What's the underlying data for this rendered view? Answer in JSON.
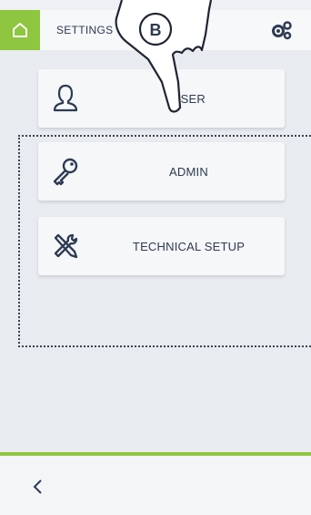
{
  "header": {
    "title": "SETTINGS",
    "home_icon": "home-icon",
    "settings_icon": "gears-icon"
  },
  "menu": [
    {
      "label": "USER",
      "icon": "user-icon"
    },
    {
      "label": "ADMIN",
      "icon": "key-icon"
    },
    {
      "label": "TECHNICAL SETUP",
      "icon": "tools-icon"
    }
  ],
  "annotation": {
    "letter": "B"
  },
  "footer": {
    "back_icon": "chevron-left-icon"
  },
  "colors": {
    "accent": "#8fc63f",
    "text": "#2d3b52"
  }
}
